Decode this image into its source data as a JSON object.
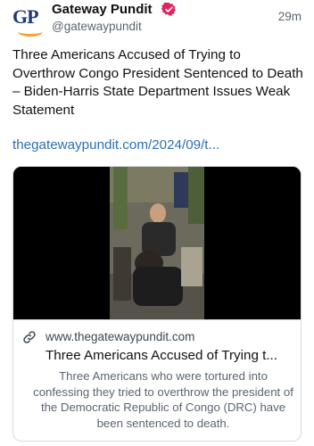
{
  "post": {
    "author": {
      "avatar_text": "GP",
      "display_name": "Gateway Pundit",
      "handle": "@gatewaypundit",
      "verified": true
    },
    "timestamp": "29m",
    "text": "Three Americans Accused of Trying to Overthrow Congo President Sentenced to Death – Biden-Harris State Department Issues Weak Statement",
    "link_text": "thegatewaypundit.com/2024/09/t...",
    "card": {
      "domain": "www.thegatewaypundit.com",
      "title": "Three Americans Accused of Trying t...",
      "description": "Three Americans who were tortured into confessing they tried to overthrow the president of the Democratic Republic of Congo (DRC) have been sentenced to death."
    }
  },
  "colors": {
    "link": "#2c6fb7",
    "brand_navy": "#1f3a74",
    "brand_orange": "#f2a52a",
    "verified_badge": "#e0245e",
    "muted_text": "#5b6470"
  },
  "icons": {
    "verified": "verified-badge-icon",
    "link": "link-chain-icon"
  }
}
